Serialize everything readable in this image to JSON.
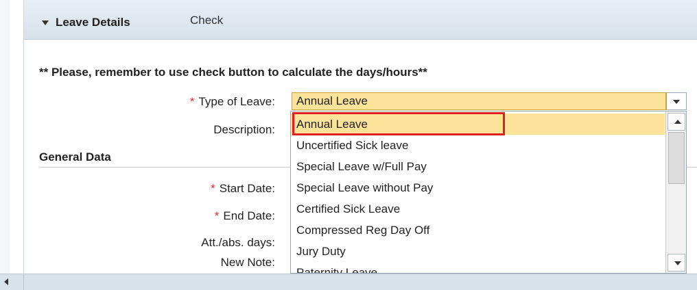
{
  "header": {
    "title": "Leave Details",
    "check_label": "Check"
  },
  "notice": "** Please, remember to use check button to calculate the days/hours**",
  "form": {
    "type_of_leave_label": "Type of Leave:",
    "description_label": "Description:",
    "general_data_title": "General Data",
    "start_date_label": "Start Date:",
    "end_date_label": "End Date:",
    "att_abs_days_label": "Att./abs. days:",
    "new_note_label": "New Note:",
    "type_of_leave_value": "Annual Leave"
  },
  "dropdown": {
    "options": [
      "Annual Leave",
      "Uncertified Sick leave",
      "Special Leave w/Full Pay",
      "Special Leave without Pay",
      "Certified Sick Leave",
      "Compressed Reg Day Off",
      "Jury Duty",
      "Paternity Leave"
    ],
    "selected_index": 0
  },
  "colors": {
    "selected_bg": "#fbe39a",
    "highlight_border": "#e02020",
    "required": "#e03030"
  },
  "icons": {
    "collapse": "triangle-down-icon",
    "dropdown_toggle": "chevron-down-icon",
    "scroll_up": "chevron-up-icon",
    "scroll_down": "chevron-down-icon",
    "scroll_left": "chevron-left-icon"
  }
}
